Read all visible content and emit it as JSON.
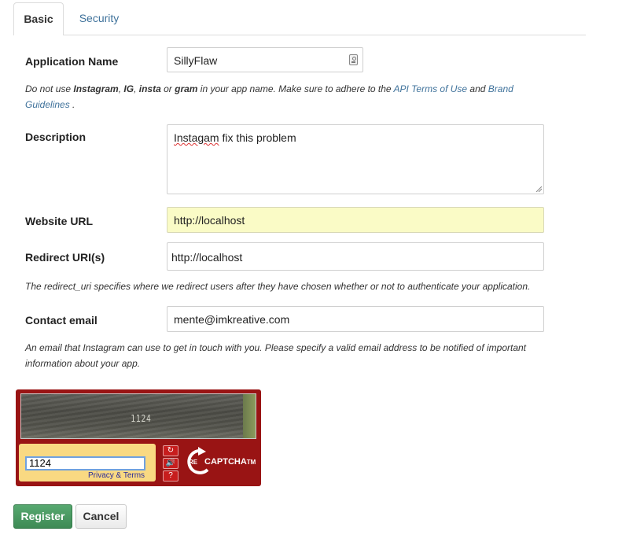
{
  "tabs": [
    {
      "label": "Basic",
      "active": true
    },
    {
      "label": "Security",
      "active": false
    }
  ],
  "form": {
    "app_name": {
      "label": "Application Name",
      "value": "SillyFlaw"
    },
    "name_help": {
      "p1": "Do not use ",
      "b1": "Instagram",
      "p2": ", ",
      "b2": "IG",
      "p3": ", ",
      "b3": "insta",
      "p4": " or ",
      "b4": "gram",
      "p5": " in your app name. Make sure to adhere to the ",
      "link1": "API Terms of Use",
      "p6": " and ",
      "link2": "Brand Guidelines",
      "p7": " ."
    },
    "description": {
      "label": "Description",
      "value_misspelled": "Instagam",
      "value_rest": " fix this problem"
    },
    "website": {
      "label": "Website URL",
      "value": "http://localhost"
    },
    "redirect": {
      "label": "Redirect URI(s)",
      "value": "http://localhost",
      "help": "The redirect_uri specifies where we redirect users after they have chosen whether or not to authenticate your application."
    },
    "email": {
      "label": "Contact email",
      "value": "mente@imkreative.com",
      "help_line1": "An email that Instagram can use to get in touch with you. Please specify a valid email address to be notified of important",
      "help_line2": "information about your app."
    }
  },
  "captcha": {
    "image_word": "1124",
    "answer": "1124",
    "privacy_link": "Privacy & Terms",
    "logo_re": "RE",
    "logo_text": "CAPTCHA",
    "logo_tm": "TM",
    "buttons": [
      "refresh-icon",
      "audio-icon",
      "help-icon"
    ],
    "accent_color": "#991414"
  },
  "actions": {
    "register_label": "Register",
    "cancel_label": "Cancel"
  },
  "colors": {
    "link": "#3f729b",
    "register_button": "#4a9a62",
    "highlight_field": "#fafbc6"
  }
}
